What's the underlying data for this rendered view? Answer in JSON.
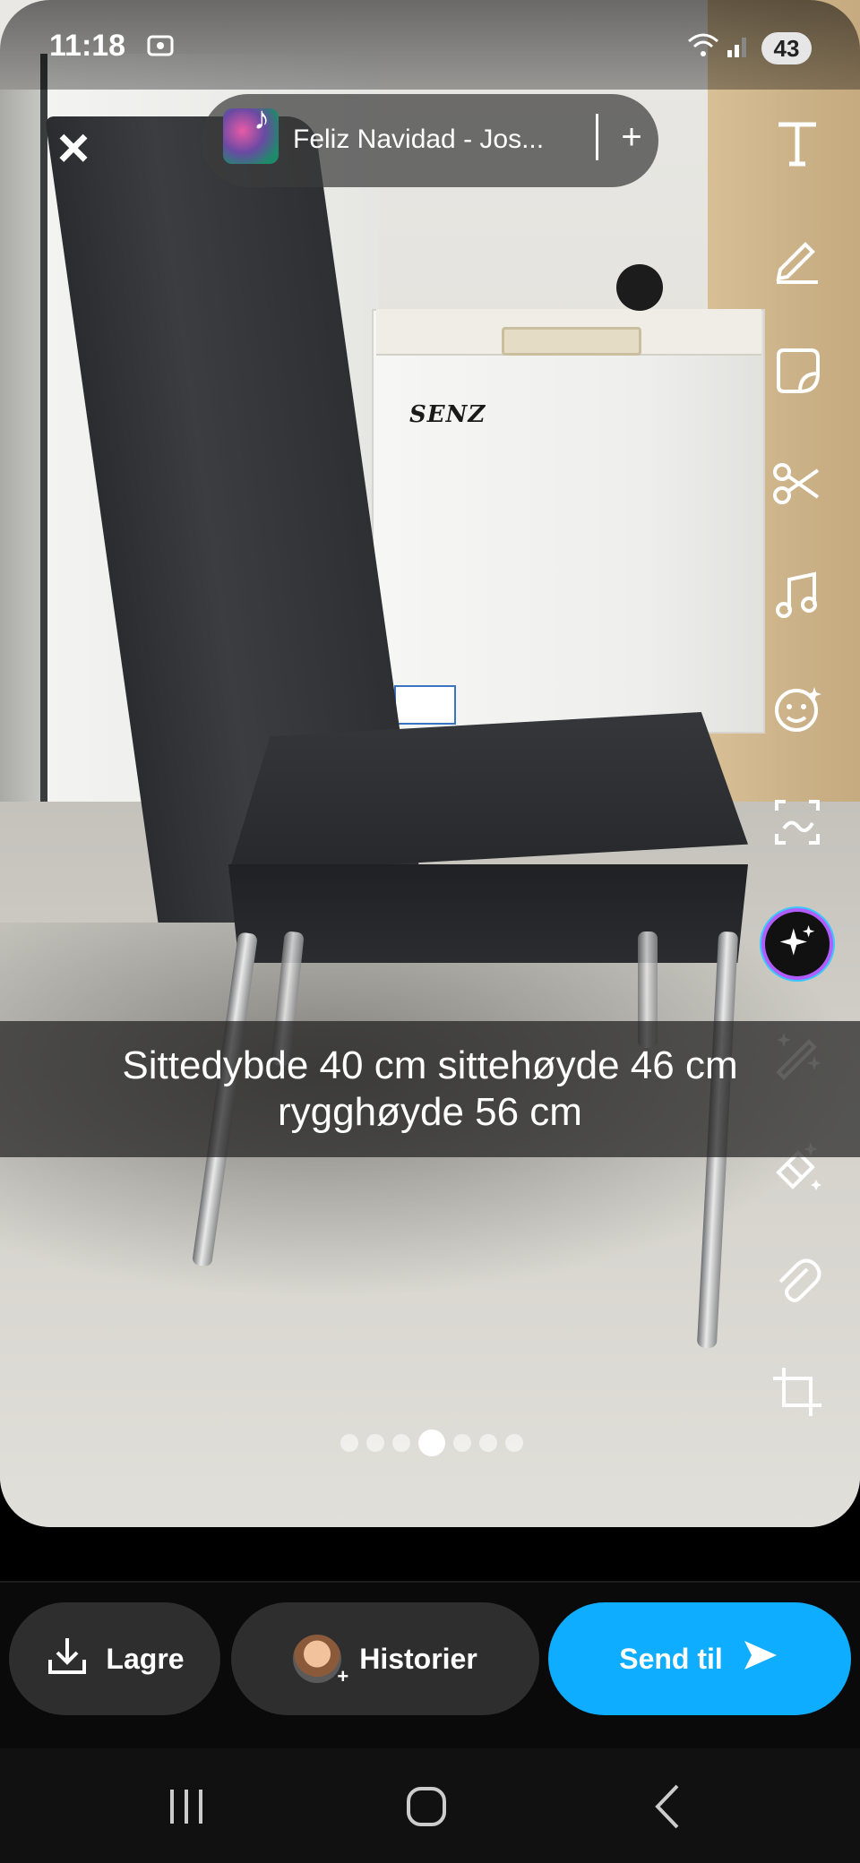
{
  "status_bar": {
    "time": "11:18",
    "battery": "43",
    "icons": [
      "screenshot-icon",
      "wifi-icon",
      "signal-icon"
    ]
  },
  "music": {
    "title": "Feliz Navidad - Jos...",
    "add_label": "+"
  },
  "photo": {
    "caption_line1": "Sittedybde 40 cm sittehøyde 46 cm",
    "caption_line2": "rygghøyde 56 cm",
    "fridge_brand": "SENZ",
    "page_count": 7,
    "active_page": 4
  },
  "toolbar": {
    "tools": [
      "text-tool",
      "draw-tool",
      "sticker-tool",
      "scissors-tool",
      "music-tool",
      "lens-tool",
      "scan-tool",
      "ai-tool",
      "magic-tool",
      "eraser-tool",
      "attach-tool",
      "crop-tool"
    ]
  },
  "actions": {
    "save_label": "Lagre",
    "stories_label": "Historier",
    "send_label": "Send til"
  },
  "colors": {
    "send_button": "#0fadff",
    "ai_ring": "#b05cff"
  }
}
